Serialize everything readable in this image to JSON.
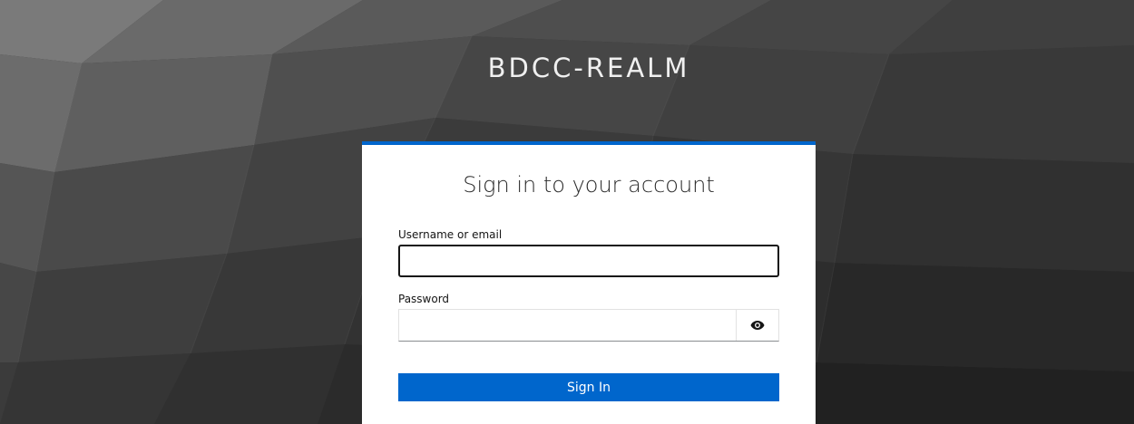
{
  "realm": {
    "name": "BDCC-REALM"
  },
  "login": {
    "title": "Sign in to your account",
    "username_label": "Username or email",
    "username_value": "",
    "password_label": "Password",
    "password_value": "",
    "show_password_icon": "eye-icon",
    "submit_label": "Sign In"
  },
  "colors": {
    "accent": "#0066cc",
    "background": "#3a3a3a",
    "card": "#ffffff"
  }
}
